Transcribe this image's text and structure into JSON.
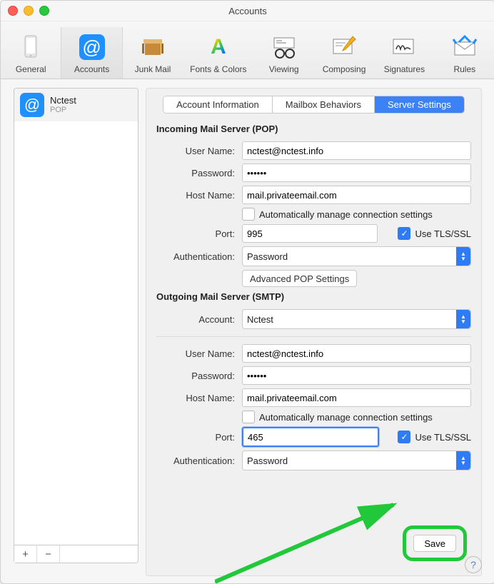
{
  "window_title": "Accounts",
  "toolbar_items": [
    "General",
    "Accounts",
    "Junk Mail",
    "Fonts & Colors",
    "Viewing",
    "Composing",
    "Signatures",
    "Rules"
  ],
  "sidebar": {
    "account_name": "Nctest",
    "account_type": "POP"
  },
  "tabs": [
    "Account Information",
    "Mailbox Behaviors",
    "Server Settings"
  ],
  "incoming": {
    "title": "Incoming Mail Server (POP)",
    "username_label": "User Name:",
    "username": "nctest@nctest.info",
    "password_label": "Password:",
    "password": "••••••",
    "host_label": "Host Name:",
    "host": "mail.privateemail.com",
    "auto_label": "Automatically manage connection settings",
    "port_label": "Port:",
    "port": "995",
    "tls_label": "Use TLS/SSL",
    "auth_label": "Authentication:",
    "auth": "Password",
    "advanced_btn": "Advanced POP Settings"
  },
  "outgoing": {
    "title": "Outgoing Mail Server (SMTP)",
    "account_label": "Account:",
    "account": "Nctest",
    "username_label": "User Name:",
    "username": "nctest@nctest.info",
    "password_label": "Password:",
    "password": "••••••",
    "host_label": "Host Name:",
    "host": "mail.privateemail.com",
    "auto_label": "Automatically manage connection settings",
    "port_label": "Port:",
    "port": "465",
    "tls_label": "Use TLS/SSL",
    "auth_label": "Authentication:",
    "auth": "Password"
  },
  "save_label": "Save"
}
